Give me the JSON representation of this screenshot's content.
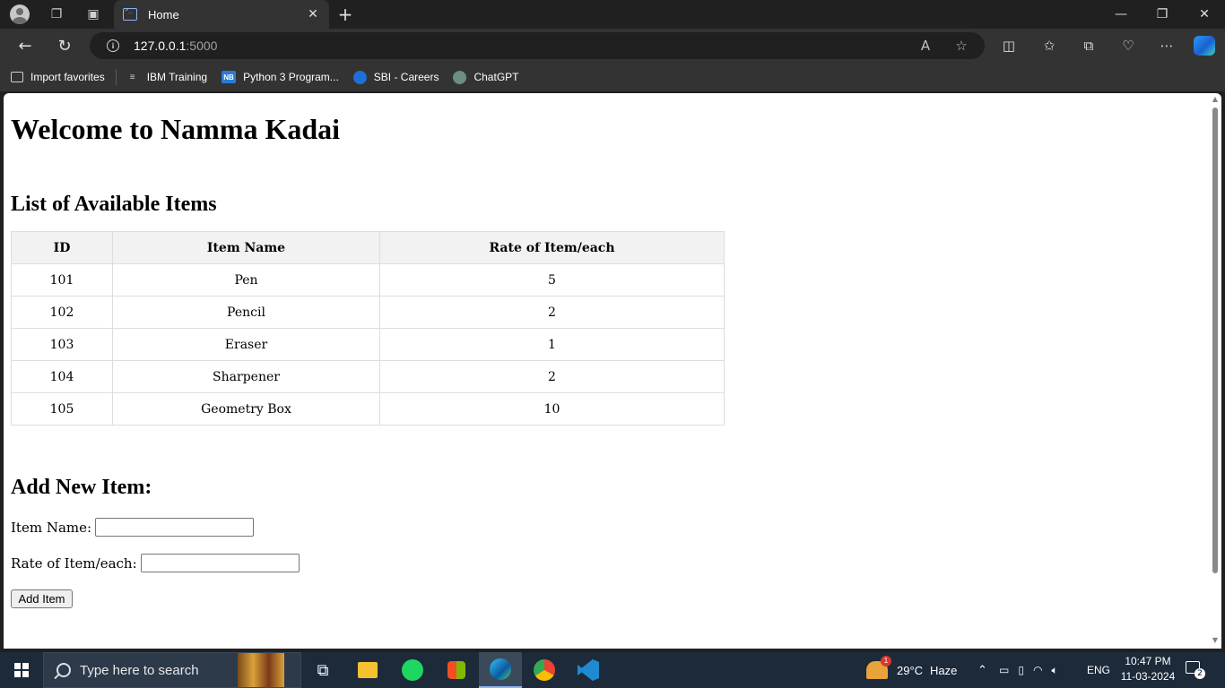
{
  "browser": {
    "tab_title": "Home",
    "url_host": "127.0.0.1",
    "url_port": ":5000",
    "favorites": [
      {
        "label": "Import favorites"
      },
      {
        "label": "IBM Training"
      },
      {
        "label": "Python 3 Program..."
      },
      {
        "label": "SBI - Careers"
      },
      {
        "label": "ChatGPT"
      }
    ],
    "fav_nb_text": "NB",
    "accent_color": "#8ab4f8"
  },
  "page": {
    "title": "Welcome to Namma Kadai",
    "list_heading": "List of Available Items",
    "table": {
      "headers": [
        "ID",
        "Item Name",
        "Rate of Item/each"
      ],
      "rows": [
        [
          "101",
          "Pen",
          "5"
        ],
        [
          "102",
          "Pencil",
          "2"
        ],
        [
          "103",
          "Eraser",
          "1"
        ],
        [
          "104",
          "Sharpener",
          "2"
        ],
        [
          "105",
          "Geometry Box",
          "10"
        ]
      ]
    },
    "form": {
      "heading": "Add New Item:",
      "name_label": "Item Name:",
      "name_value": "",
      "rate_label": "Rate of Item/each:",
      "rate_value": "",
      "submit_label": "Add Item"
    }
  },
  "taskbar": {
    "search_placeholder": "Type here to search",
    "weather_temp": "29°C",
    "weather_text": "Haze",
    "weather_badge": "1",
    "language": "ENG",
    "time": "10:47 PM",
    "date": "11-03-2024",
    "notification_count": "2"
  }
}
